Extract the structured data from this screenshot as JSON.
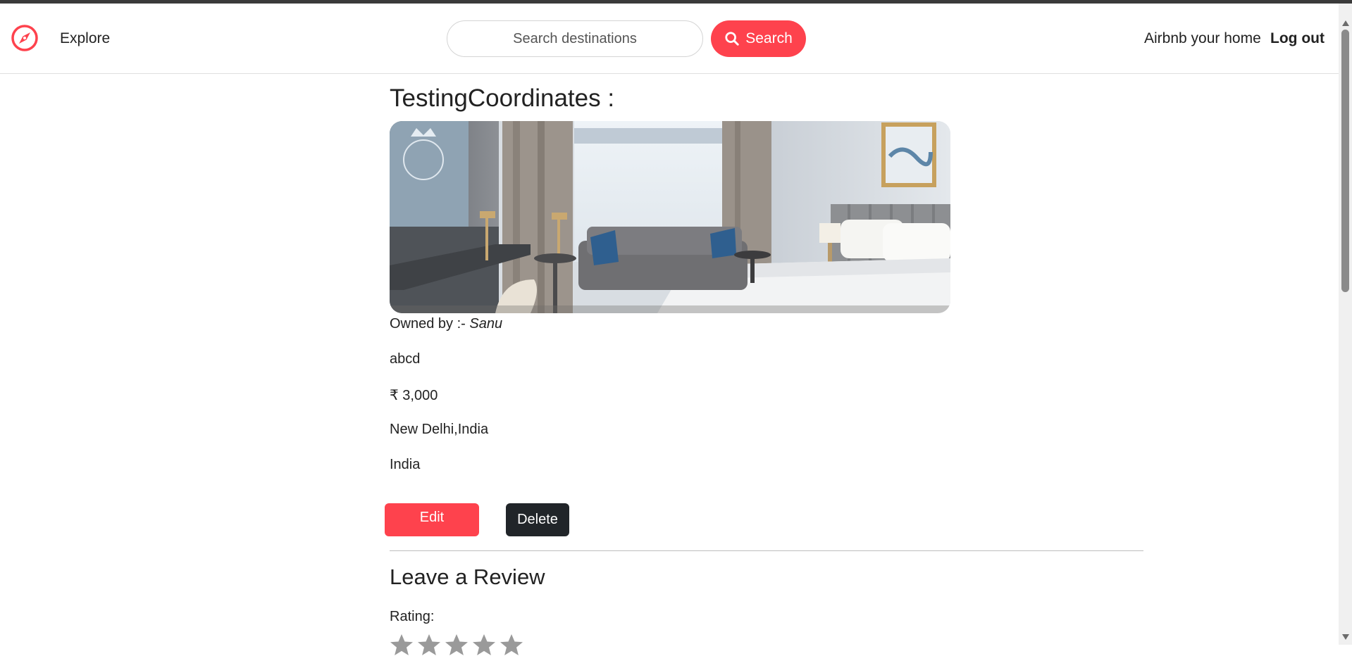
{
  "nav": {
    "explore_label": "Explore",
    "search_placeholder": "Search destinations",
    "search_button_label": "Search",
    "host_link": "Airbnb your home",
    "logout_link": "Log out",
    "icons": {
      "logo": "compass-icon",
      "search": "search-icon"
    }
  },
  "listing": {
    "title": "TestingCoordinates :",
    "owner_prefix": "Owned by :- ",
    "owner_name": "Sanu",
    "description": "abcd",
    "price": "₹ 3,000",
    "location": "New Delhi,India",
    "country": "India",
    "image_alt": "Hotel room with bed, sofa, desk and curtained window"
  },
  "actions": {
    "edit_label": "Edit",
    "delete_label": "Delete"
  },
  "review": {
    "heading": "Leave a Review",
    "rating_label": "Rating:",
    "star_count": 5
  },
  "colors": {
    "brand": "#fe424d",
    "dark_button": "#212529",
    "text": "#222222"
  }
}
